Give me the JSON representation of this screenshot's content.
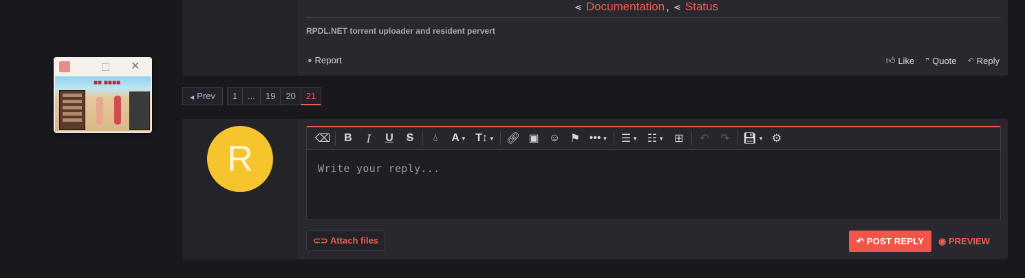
{
  "signature": {
    "link1": "Documentation",
    "link2": "Status",
    "separator": ",",
    "tagline": "RPDL.NET torrent uploader and resident pervert"
  },
  "post_actions": {
    "report": "Report",
    "like": "Like",
    "quote": "Quote",
    "reply": "Reply"
  },
  "pagination": {
    "prev": "Prev",
    "pages": [
      "1",
      "...",
      "19",
      "20",
      "21"
    ],
    "current": "21"
  },
  "reply_editor": {
    "avatar_letter": "R",
    "placeholder": "Write your reply...",
    "attach_label": "Attach files",
    "post_label": "POST REPLY",
    "preview_label": "PREVIEW"
  },
  "colors": {
    "accent": "#ee5c4e",
    "avatar_bg": "#f6c52d",
    "background": "#18181d",
    "panel": "#28282e"
  }
}
